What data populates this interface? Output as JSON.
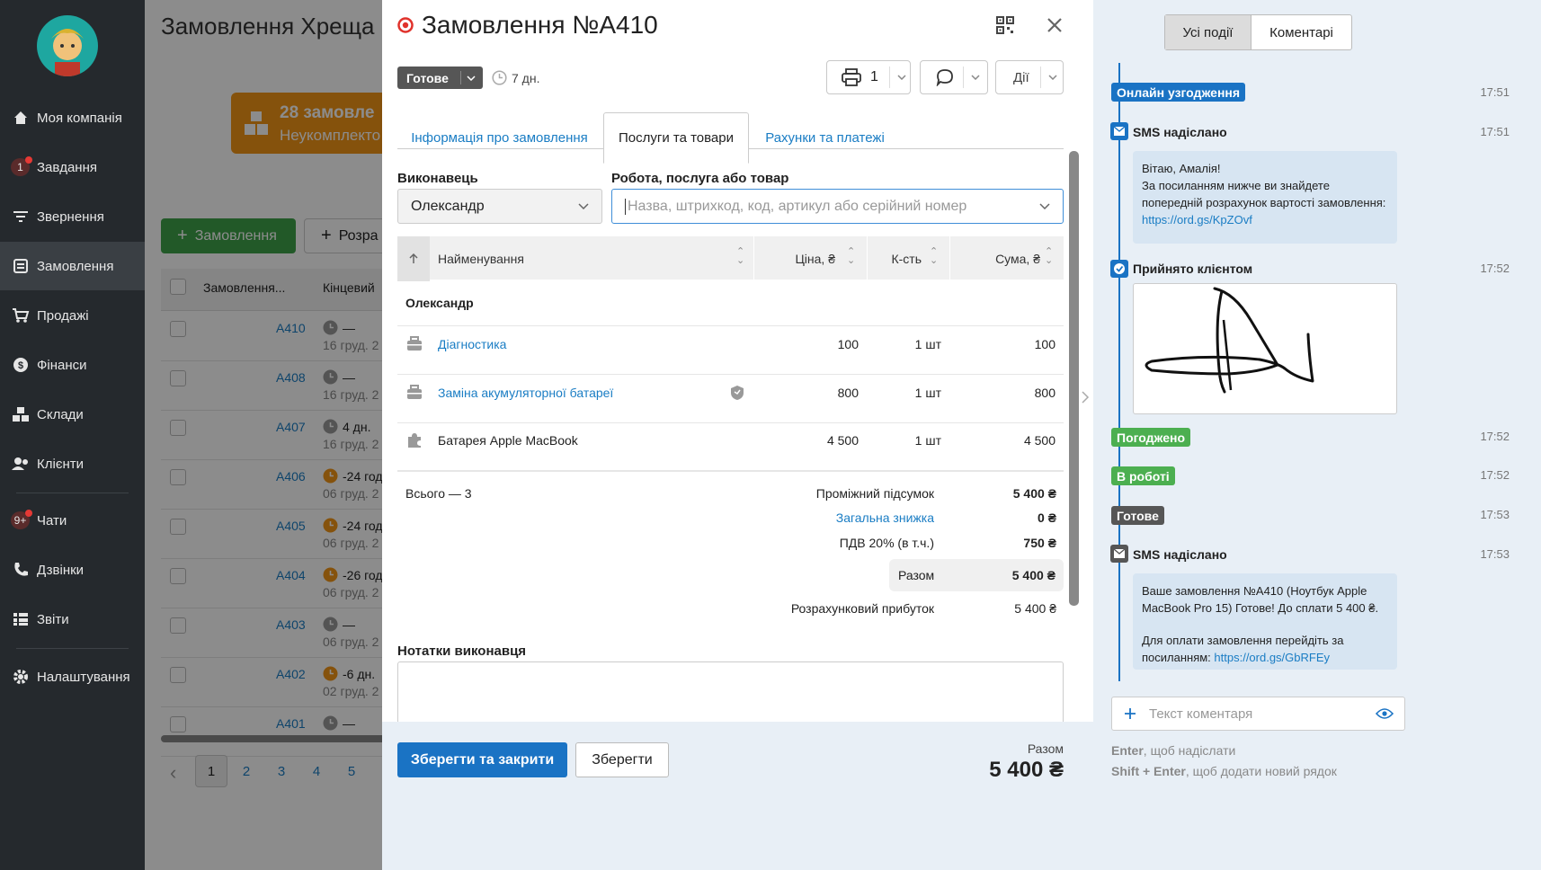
{
  "sidebar": {
    "items": [
      {
        "label": "Моя компанія",
        "icon": "home-icon"
      },
      {
        "label": "Завдання",
        "icon": "tasks-icon",
        "badge": "1"
      },
      {
        "label": "Звернення",
        "icon": "filter-icon"
      },
      {
        "label": "Замовлення",
        "icon": "orders-icon"
      },
      {
        "label": "Продажі",
        "icon": "cart-icon"
      },
      {
        "label": "Фінанси",
        "icon": "dollar-icon"
      },
      {
        "label": "Склади",
        "icon": "warehouse-icon"
      },
      {
        "label": "Клієнти",
        "icon": "clients-icon"
      },
      {
        "label": "Чати",
        "icon": "chat-icon",
        "badge": "9+"
      },
      {
        "label": "Дзвінки",
        "icon": "phone-icon"
      },
      {
        "label": "Звіти",
        "icon": "reports-icon"
      },
      {
        "label": "Налаштування",
        "icon": "gear-icon"
      }
    ]
  },
  "background": {
    "page_title": "Замовлення Хреща",
    "banner_count": "28 замовле",
    "banner_sub": "Неукомплекто",
    "add_order": "Замовлення",
    "calc": "Розра",
    "col_order": "Замовлення...",
    "col_deadline": "Кінцевий",
    "rows": [
      {
        "id": "A410",
        "eta": "—",
        "date": "16 груд. 2"
      },
      {
        "id": "A408",
        "eta": "—",
        "date": "16 груд. 2"
      },
      {
        "id": "A407",
        "eta": "4 дн.",
        "date": "16 груд. 2"
      },
      {
        "id": "A406",
        "eta": "-24 год",
        "date": "06 груд. 2"
      },
      {
        "id": "A405",
        "eta": "-24 год",
        "date": "06 груд. 2"
      },
      {
        "id": "A404",
        "eta": "-26 год",
        "date": "06 груд. 2"
      },
      {
        "id": "A403",
        "eta": "—",
        "date": "06 груд. 2"
      },
      {
        "id": "A402",
        "eta": "-6 дн.",
        "date": "02 груд. 2"
      },
      {
        "id": "A401",
        "eta": "—",
        "date": ""
      }
    ],
    "pages": [
      "1",
      "2",
      "3",
      "4",
      "5"
    ]
  },
  "modal": {
    "title": "Замовлення №A410",
    "status": "Готове",
    "duration": "7 дн.",
    "print_count": "1",
    "actions": "Дії",
    "tabs": [
      "Інформація про замовлення",
      "Послуги та товари",
      "Рахунки та платежі"
    ],
    "executor_label": "Виконавець",
    "executor_value": "Олександр",
    "work_label": "Робота, послуга або товар",
    "work_placeholder": "Назва, штрихкод, код, артикул або серійний номер",
    "columns": {
      "name": "Найменування",
      "price": "Ціна, ₴",
      "qty": "К-сть",
      "sum": "Сума, ₴"
    },
    "group": "Олександр",
    "items": [
      {
        "name": "Діагностика",
        "price": "100",
        "qty": "1 шт",
        "sum": "100",
        "kind": "service"
      },
      {
        "name": "Заміна акумуляторної батареї",
        "price": "800",
        "qty": "1 шт",
        "sum": "800",
        "kind": "service"
      },
      {
        "name": "Батарея Apple MacBook",
        "price": "4 500",
        "qty": "1 шт",
        "sum": "4 500",
        "kind": "product"
      }
    ],
    "total_count_label": "Всього — ",
    "total_count": "3",
    "subtotal_label": "Проміжний підсумок",
    "subtotal": "5 400 ₴",
    "discount_label": "Загальна знижка",
    "discount": "0 ₴",
    "vat_label": "ПДВ 20% (в т.ч.)",
    "vat": "750 ₴",
    "sum_label": "Разом",
    "sum": "5 400 ₴",
    "profit_label": "Розрахунковий прибуток",
    "profit": "5 400 ₴",
    "notes_label": "Нотатки виконавця",
    "save_close": "Зберегти та закрити",
    "save": "Зберегти",
    "footer_total_label": "Разом",
    "footer_total": "5 400 ₴"
  },
  "feed": {
    "tab_all": "Усі події",
    "tab_comments": "Коментарі",
    "events": {
      "online": {
        "label": "Онлайн узгодження",
        "time": "17:51"
      },
      "sms1": {
        "label": "SMS надіслано",
        "time": "17:51",
        "text1": "Вітаю, Амалія!",
        "text2": "За посиланням нижче ви знайдете попередній розрахунок вартості замовлення:",
        "link": "https://ord.gs/KpZOvf"
      },
      "accepted": {
        "label": "Прийнято клієнтом",
        "time": "17:52"
      },
      "agreed": {
        "label": "Погоджено",
        "time": "17:52"
      },
      "inwork": {
        "label": "В роботі",
        "time": "17:52"
      },
      "ready": {
        "label": "Готове",
        "time": "17:53"
      },
      "sms2": {
        "label": "SMS надіслано",
        "time": "17:53",
        "text1": "Ваше замовлення №A410 (Ноутбук Apple MacBook Pro 15) Готове! До сплати 5 400 ₴.",
        "text2": "Для оплати замовлення перейдіть за посиланням: ",
        "link": "https://ord.gs/GbRFEy"
      }
    },
    "comment_placeholder": "Текст коментаря",
    "hint1_key": "Enter",
    "hint1_text": ", щоб надіслати",
    "hint2_key": "Shift + Enter",
    "hint2_text": ", щоб додати новий рядок"
  },
  "colors": {
    "primary": "#1a73c4",
    "green": "#4caf50",
    "orange": "#f29516",
    "dark": "#25292d",
    "status": "#565656"
  }
}
